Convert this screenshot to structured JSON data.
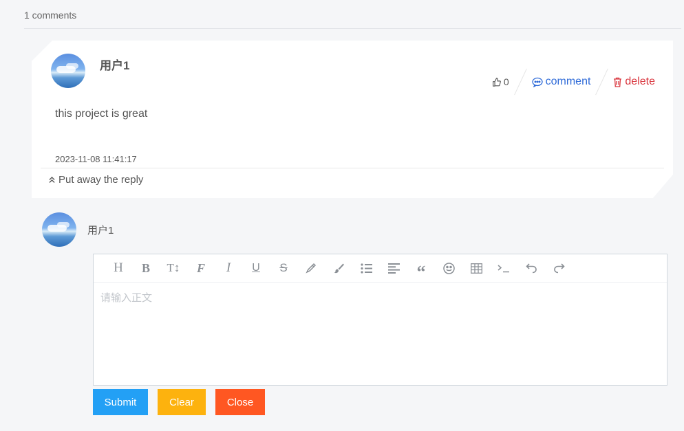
{
  "comments_count": "1 comments",
  "comment": {
    "username": "用户1",
    "likes": "0",
    "comment_label": "comment",
    "delete_label": "delete",
    "text": "this project is great",
    "date": "2023-11-08 11:41:17",
    "put_away_label": "Put away the reply"
  },
  "reply": {
    "username": "用户1",
    "placeholder": "请输入正文",
    "toolbar_icons": [
      "heading-icon",
      "bold-icon",
      "font-size-icon",
      "font-family-icon",
      "italic-icon",
      "underline-icon",
      "strikethrough-icon",
      "pen-icon",
      "brush-icon",
      "list-icon",
      "align-left-icon",
      "quote-icon",
      "emoji-icon",
      "table-icon",
      "code-icon",
      "undo-icon",
      "redo-icon"
    ],
    "submit_label": "Submit",
    "clear_label": "Clear",
    "close_label": "Close"
  },
  "colors": {
    "comment_link": "#2f6bd8",
    "delete_link": "#d9363e",
    "submit": "#23a0f5",
    "clear": "#fdb20e",
    "close": "#ff5722"
  }
}
